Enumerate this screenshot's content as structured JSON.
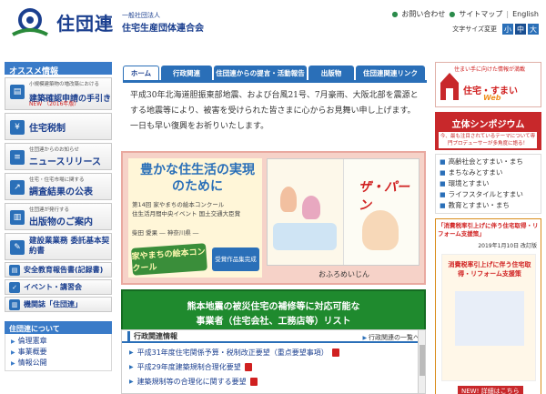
{
  "header": {
    "logo_text": "住団連",
    "org_type": "一般社団法人",
    "org_name": "住宅生産団体連合会",
    "links": [
      "お問い合わせ",
      "サイトマップ",
      "English"
    ],
    "font_size_label": "文字サイズ変更",
    "font_sizes": [
      "小",
      "中",
      "大"
    ]
  },
  "sidebar": {
    "title": "オススメ情報",
    "first": {
      "small": "小規模建築物の増改築における",
      "main": "建築確認申請の手引き",
      "new": "NEW （2016年版）"
    },
    "items": [
      {
        "small": "",
        "main": "住宅税制"
      },
      {
        "small": "住団連からのお知らせ",
        "main": "ニュースリリース"
      },
      {
        "small": "住宅・住宅市場に関する",
        "main": "調査結果の公表"
      },
      {
        "small": "住団連が発行する",
        "main": "出版物のご案内"
      },
      {
        "small": "",
        "main": "建設業業務 委託基本契約書"
      }
    ],
    "short_items": [
      "安全教育報告書(記録書)",
      "イベント・講習会",
      "機関誌「住団連」"
    ],
    "about_title": "住団連について",
    "about_items": [
      "倫理憲章",
      "事業概要",
      "情報公開"
    ]
  },
  "nav": {
    "tabs": [
      "ホーム",
      "行政関連",
      "住団連からの提言・活動報告",
      "出版物",
      "住団連関連リンク"
    ]
  },
  "message": "平成30年北海道胆振東部地震、および台風21号、7月豪雨、大阪北部を震源とする地震等により、被害を受けられた皆さまに心からお見舞い申し上げます。一日も早い復興をお祈りいたします。",
  "banner": {
    "heading": "豊かな住生活の実現のために",
    "line1": "第14回 家やまちの絵本コンクール",
    "line2": "住生活月間中央イベント 国土交通大臣賞",
    "author": "柴田 愛果 ― 神奈川県 ―",
    "badge": "家やまちの絵本コンクール",
    "prize": "受賞作品集完成",
    "book_title": "ザ・パーン",
    "caption": "おふろめいじん"
  },
  "green_box": {
    "line1": "熊本地震の被災住宅の補修等に対応可能な",
    "line2": "事業者（住宅会社、工務店等）リスト"
  },
  "news": {
    "title": "行政関連情報",
    "more": "行政関連の一覧へ",
    "items": [
      "平成31年度住宅関係予算・税制改正要望（重点要望事項）",
      "平成29年度建築規制合理化要望",
      "建築規制等の合理化に関する要望"
    ]
  },
  "right": {
    "box1_head": "住まい手に向けた情報が満載",
    "box1_big": "住宅・すまい",
    "box1_web": "Web",
    "sympo_title": "立体シンポジウム",
    "sympo_sub": "今、最も注目されているテーマについて専門プロデューサーが多角度に語る！",
    "links": [
      "高齢社会とすまい・まち",
      "まちなみとすまい",
      "環境とすまい",
      "ライフスタイルとすまい",
      "教育とすまい・まち"
    ],
    "book_head": "「消費税率引上げに伴う住宅取得・リフォーム支援策」",
    "book_date": "2019年1月10日 改訂版",
    "book_cover_title": "消費税率引上げに伴う住宅取得・リフォーム支援策",
    "book_new": "NEW! 詳細はこちら"
  },
  "colors": {
    "brand_blue": "#1b3f8f",
    "accent_blue": "#2a6fb8",
    "green": "#1f8a2e",
    "red": "#c8282b"
  }
}
